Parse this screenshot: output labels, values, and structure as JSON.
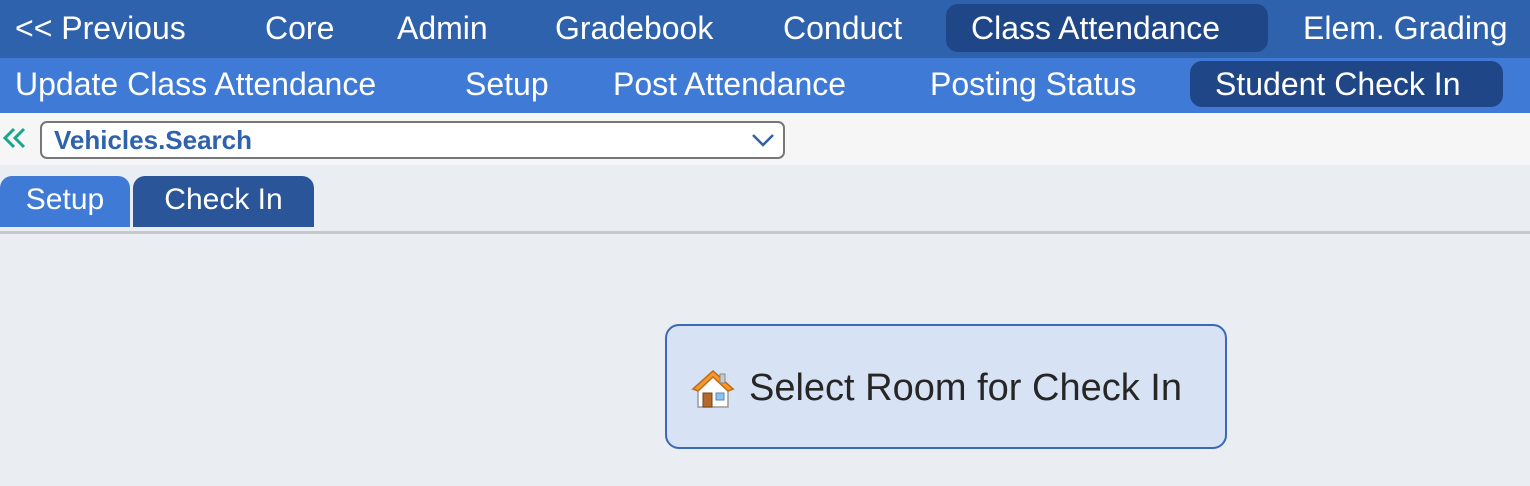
{
  "top_nav": {
    "items": [
      {
        "label": "<< Previous"
      },
      {
        "label": "Core"
      },
      {
        "label": "Admin"
      },
      {
        "label": "Gradebook"
      },
      {
        "label": "Conduct"
      },
      {
        "label": "Class Attendance",
        "active": true
      },
      {
        "label": "Elem. Grading"
      }
    ]
  },
  "sub_nav": {
    "items": [
      {
        "label": "Update Class Attendance"
      },
      {
        "label": "Setup"
      },
      {
        "label": "Post Attendance"
      },
      {
        "label": "Posting Status"
      },
      {
        "label": "Student Check In",
        "active": true
      }
    ]
  },
  "search": {
    "collapse_icon": "double-chevron-left-icon",
    "selected_value": "Vehicles.Search",
    "dropdown_icon": "chevron-down-icon"
  },
  "tabs": [
    {
      "label": "Setup"
    },
    {
      "label": "Check In",
      "active": true
    }
  ],
  "main": {
    "room_button_label": "Select Room for Check In",
    "room_button_icon": "house-icon"
  },
  "colors": {
    "top_nav_bg": "#2f62ad",
    "sub_nav_bg": "#3f7bd6",
    "active_bg": "#1f4687",
    "accent_teal": "#1aa58c",
    "button_bg": "#d7e2f4"
  }
}
